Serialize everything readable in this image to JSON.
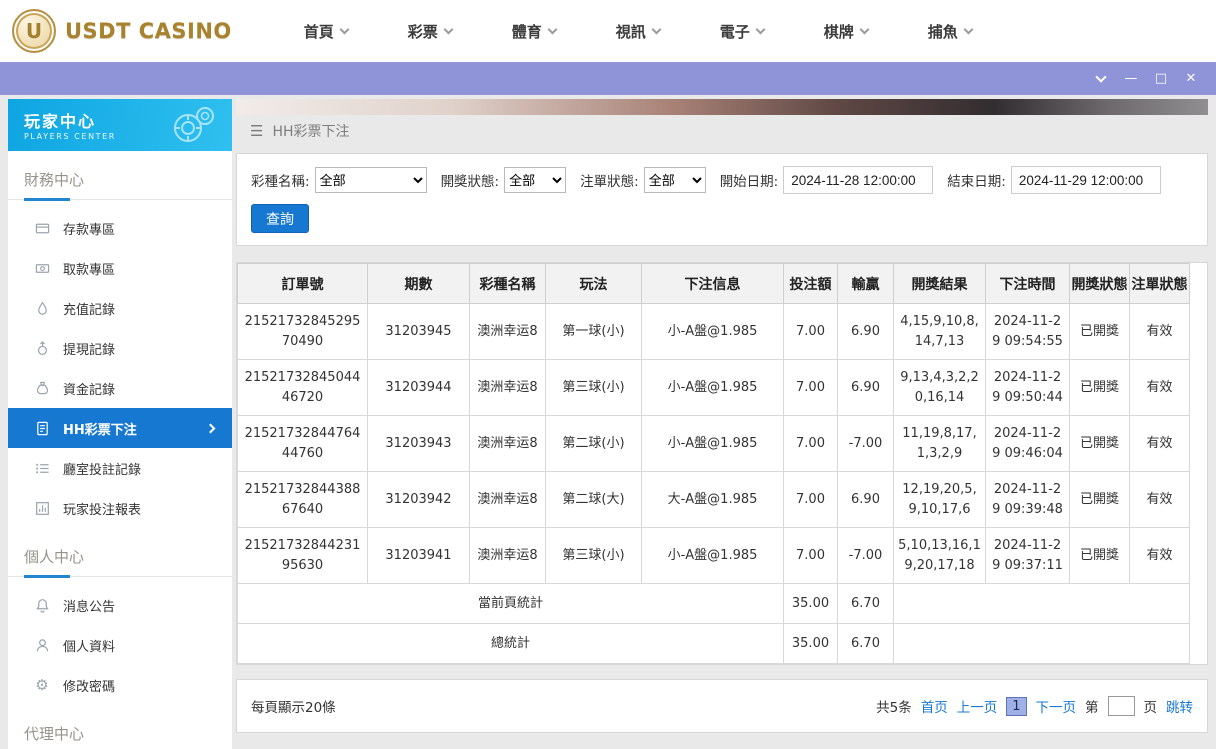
{
  "colors": {
    "accent_blue": "#1778d2",
    "titlebar_purple": "#8f93d7",
    "sidebar_header_blue": "#18abe4",
    "logo_gold": "#a9822e"
  },
  "icons": {
    "logo_mark": "U",
    "hamburger": "☰",
    "minimize": "—",
    "maximize": "□",
    "close": "✕",
    "gear": "⚙"
  },
  "top_nav": {
    "logo_text": "USDT CASINO",
    "items": [
      {
        "label": "首頁",
        "icon": "chevron-down-icon"
      },
      {
        "label": "彩票",
        "icon": "chevron-down-icon"
      },
      {
        "label": "體育",
        "icon": "chevron-down-icon"
      },
      {
        "label": "視訊",
        "icon": "chevron-down-icon"
      },
      {
        "label": "電子",
        "icon": "chevron-down-icon"
      },
      {
        "label": "棋牌",
        "icon": "chevron-down-icon"
      },
      {
        "label": "捕魚",
        "icon": "chevron-down-icon"
      }
    ]
  },
  "sidebar": {
    "title": "玩家中心",
    "subtitle": "PLAYERS CENTER",
    "sections": [
      {
        "label": "財務中心",
        "items": [
          {
            "label": "存款專區",
            "icon": "deposit-card-icon",
            "active": false
          },
          {
            "label": "取款專區",
            "icon": "withdraw-cash-icon",
            "active": false
          },
          {
            "label": "充值記錄",
            "icon": "recharge-record-icon",
            "active": false
          },
          {
            "label": "提現記錄",
            "icon": "cashout-record-icon",
            "active": false
          },
          {
            "label": "資金記錄",
            "icon": "funds-record-icon",
            "active": false
          },
          {
            "label": "HH彩票下注",
            "icon": "lottery-bets-icon",
            "active": true
          },
          {
            "label": "廳室投註記錄",
            "icon": "hall-bet-record-icon",
            "active": false
          },
          {
            "label": "玩家投注報表",
            "icon": "bet-report-icon",
            "active": false
          }
        ]
      },
      {
        "label": "個人中心",
        "items": [
          {
            "label": "消息公告",
            "icon": "bell-icon",
            "active": false
          },
          {
            "label": "個人資料",
            "icon": "person-icon",
            "active": false
          },
          {
            "label": "修改密碼",
            "icon": "gear-icon",
            "active": false
          }
        ]
      },
      {
        "label": "代理中心",
        "items": []
      }
    ]
  },
  "main": {
    "breadcrumb": "HH彩票下注",
    "filters": {
      "lottery_label": "彩種名稱:",
      "lottery_value": "全部",
      "draw_status_label": "開獎狀態:",
      "draw_status_value": "全部",
      "order_status_label": "注單狀態:",
      "order_status_value": "全部",
      "start_date_label": "開始日期:",
      "start_date_value": "2024-11-28 12:00:00",
      "end_date_label": "結束日期:",
      "end_date_value": "2024-11-29 12:00:00",
      "query_button": "查詢"
    },
    "table": {
      "headers": [
        "訂單號",
        "期數",
        "彩種名稱",
        "玩法",
        "下注信息",
        "投注額",
        "輸贏",
        "開獎結果",
        "下注時間",
        "開獎狀態",
        "注單狀態"
      ],
      "rows": [
        [
          "2152173284529570490",
          "31203945",
          "澳洲幸运8",
          "第一球(小)",
          "小-A盤@1.985",
          "7.00",
          "6.90",
          "4,15,9,10,8,14,7,13",
          "2024-11-29 09:54:55",
          "已開獎",
          "有效"
        ],
        [
          "2152173284504446720",
          "31203944",
          "澳洲幸运8",
          "第三球(小)",
          "小-A盤@1.985",
          "7.00",
          "6.90",
          "9,13,4,3,2,20,16,14",
          "2024-11-29 09:50:44",
          "已開獎",
          "有效"
        ],
        [
          "2152173284476444760",
          "31203943",
          "澳洲幸运8",
          "第二球(小)",
          "小-A盤@1.985",
          "7.00",
          "-7.00",
          "11,19,8,17,1,3,2,9",
          "2024-11-29 09:46:04",
          "已開獎",
          "有效"
        ],
        [
          "2152173284438867640",
          "31203942",
          "澳洲幸运8",
          "第二球(大)",
          "大-A盤@1.985",
          "7.00",
          "6.90",
          "12,19,20,5,9,10,17,6",
          "2024-11-29 09:39:48",
          "已開獎",
          "有效"
        ],
        [
          "2152173284423195630",
          "31203941",
          "澳洲幸运8",
          "第三球(小)",
          "小-A盤@1.985",
          "7.00",
          "-7.00",
          "5,10,13,16,19,20,17,18",
          "2024-11-29 09:37:11",
          "已開獎",
          "有效"
        ]
      ],
      "summary": [
        {
          "label": "當前頁統計",
          "bet_total": "35.00",
          "win_loss": "6.70"
        },
        {
          "label": "總統計",
          "bet_total": "35.00",
          "win_loss": "6.70"
        }
      ]
    },
    "footer": {
      "page_size": "每頁顯示20條",
      "total": "共5条",
      "first": "首页",
      "prev": "上一页",
      "current_page": "1",
      "next": "下一页",
      "jump_prefix": "第",
      "jump_suffix": "页",
      "jump": "跳转"
    }
  }
}
